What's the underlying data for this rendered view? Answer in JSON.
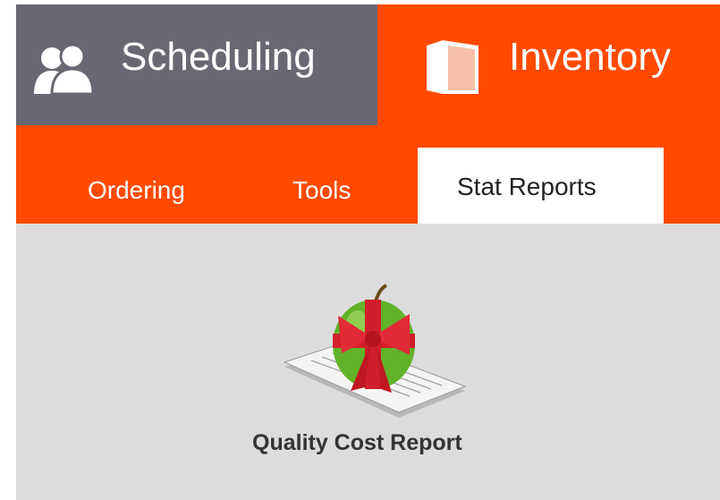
{
  "top_tabs": {
    "scheduling": {
      "label": "Scheduling",
      "icon": "people-icon",
      "bg": "#686872"
    },
    "inventory": {
      "label": "Inventory",
      "icon": "book-icon",
      "bg": "#ff4a00"
    }
  },
  "subnav": {
    "items": [
      {
        "label": "Ordering"
      },
      {
        "label": "Tools"
      },
      {
        "label": "Stat Reports",
        "active": true
      }
    ]
  },
  "reports": {
    "tiles": [
      {
        "label": "Quality Cost Report",
        "icon": "apple-report-icon"
      }
    ]
  }
}
